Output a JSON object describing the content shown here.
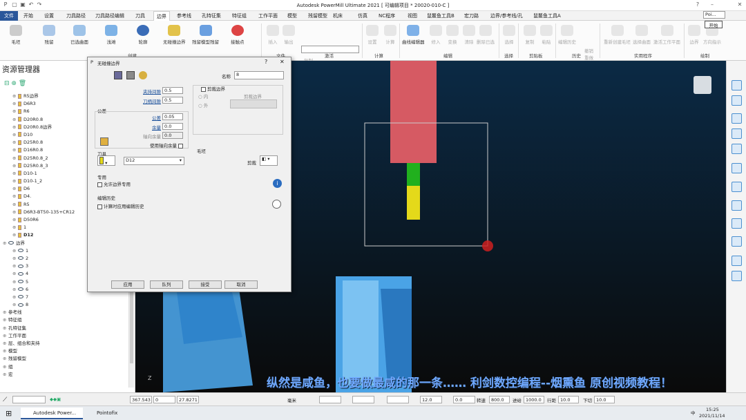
{
  "titlebar": {
    "title": "Autodesk PowerMill Ultimate 2021    [ 可编辑项目 * 20020-010-C ]"
  },
  "tabs": [
    "文件",
    "开始",
    "设置",
    "刀具路径",
    "刀具路径编辑",
    "刀具",
    "边界",
    "参考线",
    "孔特征集",
    "特征组",
    "工作平面",
    "模型",
    "残留模型",
    "机床",
    "仿真",
    "NC程序",
    "视图",
    "鼠鳌鱼工具B",
    "宏刀路",
    "边界/参考线/孔",
    "鼠鳌鱼工具A"
  ],
  "tooltip": {
    "search": "Poi...",
    "start": "开始"
  },
  "ribbon": {
    "buttons": [
      "毛坯",
      "残留",
      "已选曲面",
      "浅滩",
      "轮廓",
      "无碰撞边界",
      "残留模型残留",
      "接触点"
    ],
    "create_group": "创建",
    "file_group": "文件",
    "file_buttons": [
      "插入",
      "输出"
    ],
    "clip_items": [
      "复制",
      "粘贴",
      "删除"
    ],
    "activate_group": "激活",
    "calc_group": "计算",
    "calc_buttons": [
      "设置",
      "计算"
    ],
    "edit_group": "编辑",
    "edit_buttons": [
      "曲线编辑器",
      "修入",
      "变换",
      "清除",
      "删除已选"
    ],
    "select_group": "选择",
    "select_buttons": [
      "选择"
    ],
    "clipboard_group": "剪贴板",
    "clipboard_buttons": [
      "复制",
      "粘贴"
    ],
    "history_group": "历史",
    "history_buttons": [
      "编辑历史",
      "撤销",
      "重做"
    ],
    "util_group": "实用程序",
    "util_buttons": [
      "重新创建毛坯",
      "选择曲面",
      "激活工作平面"
    ],
    "draw_group": "绘制",
    "draw_buttons": [
      "边界",
      "方向指示"
    ]
  },
  "explorer": {
    "title": "资源管理器",
    "tools": [
      "R5边界",
      "D6R3",
      "R6",
      "D20R0.8",
      "D20R0.8边界",
      "D10",
      "D25R0.8",
      "D16R0.8",
      "D25R0.8_2",
      "D25R0.8_3",
      "D10-1",
      "D10-1_2",
      "D6",
      "D4.",
      "R5",
      "D6R3-BT50-135+CR12",
      "D50R6",
      "1",
      "D12"
    ],
    "tool_top": "D6R3-BT50-135+CR12",
    "boundary_root": "边界",
    "boundaries": [
      "1",
      "2",
      "3",
      "4",
      "5",
      "6",
      "7",
      "8"
    ],
    "others": [
      "参考线",
      "特征组",
      "孔特征集",
      "工作平面",
      "层、组合和夹持",
      "模型",
      "残留模型",
      "组",
      "宏"
    ]
  },
  "dialog": {
    "title": "无碰撞边界",
    "name_label": "名称",
    "name_value": "8",
    "shank_label": "夹持间隙",
    "shank_value": "0.5",
    "holder_label": "刀柄间隙",
    "holder_value": "0.5",
    "tolerance_section": "公差",
    "tol_label": "公差",
    "tol_value": "0.05",
    "allowance_label": "余量",
    "allowance_value": "0.0",
    "axial_label": "轴向余量",
    "axial_value": "0.0",
    "use_axial": "使用轴向余量",
    "clip_label": "剪裁边界",
    "inner": "内",
    "outer": "外",
    "clip_boundary": "剪裁边界",
    "tool_section": "刀具",
    "tool_value": "D12",
    "block_section": "毛坯",
    "clip_btn": "剪裁",
    "special_section": "专用",
    "allow_special": "允许边界专用",
    "history_section": "编辑历史",
    "apply_history": "计算时应用编辑历史",
    "buttons": [
      "应用",
      "队列",
      "接受",
      "取消"
    ],
    "help": "?",
    "close": "✕"
  },
  "status": {
    "x": "367.543",
    "y": "0",
    "z": "27.8271",
    "unit": "毫米",
    "tol": "12.0",
    "thick": "0.0",
    "speed_label": "转速",
    "speed": "800.0",
    "feed_label": "进给",
    "feed": "1000.0",
    "step_label": "行距",
    "step": "10.0",
    "down_label": "下切",
    "down": "10.0"
  },
  "subtitle": "纵然是咸鱼，也要做最咸的那一条……   利剑数控编程--烟熏鱼 原创视频教程！",
  "taskbar": {
    "apps": [
      "Autodesk Power...",
      "Pointofix"
    ],
    "time": "15:25",
    "date": "2021/11/14",
    "ime": "中"
  }
}
